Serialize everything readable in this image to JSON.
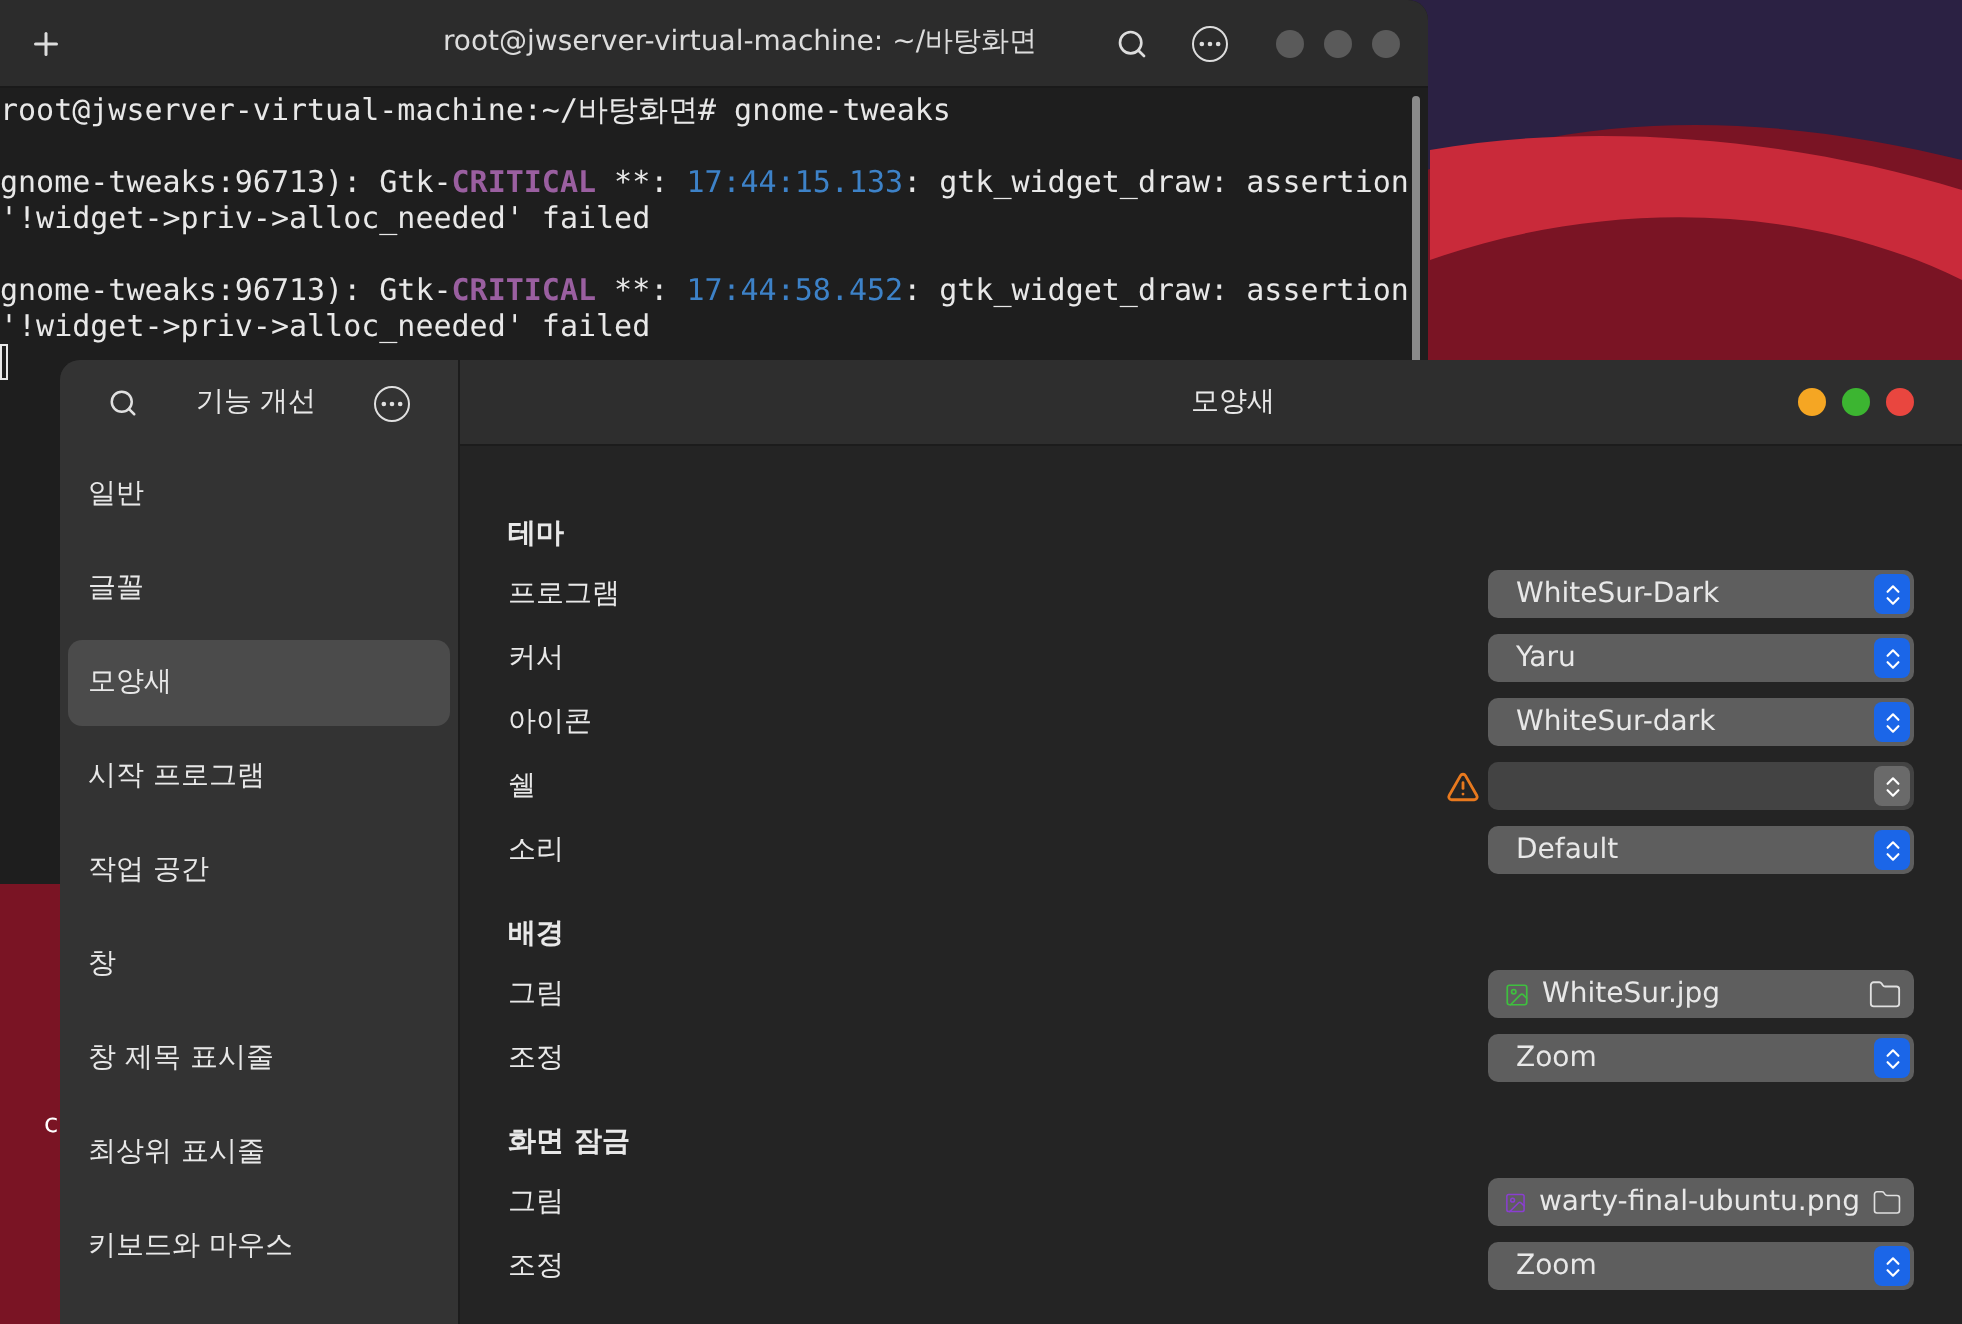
{
  "desktop": {
    "icon_label": "c"
  },
  "terminal": {
    "title": "root@jwserver-virtual-machine: ~/바탕화면",
    "blocks": [
      {
        "lines": [
          [
            {
              "text": "root@jwserver-virtual-machine:~/바탕화면# gnome-tweaks",
              "kind": "plain"
            }
          ]
        ]
      },
      {
        "lines": [
          [
            {
              "text": "gnome-tweaks:96713): Gtk-",
              "kind": "plain"
            },
            {
              "text": "CRITICAL",
              "kind": "critical"
            },
            {
              "text": " **: ",
              "kind": "plain"
            },
            {
              "text": "17:44:15.133",
              "kind": "time"
            },
            {
              "text": ": gtk_widget_draw: assertion",
              "kind": "plain"
            }
          ],
          [
            {
              "text": "'!widget->priv->alloc_needed' failed",
              "kind": "plain"
            }
          ]
        ]
      },
      {
        "lines": [
          [
            {
              "text": "gnome-tweaks:96713): Gtk-",
              "kind": "plain"
            },
            {
              "text": "CRITICAL",
              "kind": "critical"
            },
            {
              "text": " **: ",
              "kind": "plain"
            },
            {
              "text": "17:44:58.452",
              "kind": "time"
            },
            {
              "text": ": gtk_widget_draw: assertion",
              "kind": "plain"
            }
          ],
          [
            {
              "text": "'!widget->priv->alloc_needed' failed",
              "kind": "plain"
            }
          ]
        ]
      }
    ]
  },
  "tweaks": {
    "app_title": "기능 개선",
    "page_title": "모양새",
    "sidebar": {
      "items": [
        {
          "label": "일반",
          "selected": false
        },
        {
          "label": "글꼴",
          "selected": false
        },
        {
          "label": "모양새",
          "selected": true
        },
        {
          "label": "시작 프로그램",
          "selected": false
        },
        {
          "label": "작업 공간",
          "selected": false
        },
        {
          "label": "창",
          "selected": false
        },
        {
          "label": "창 제목 표시줄",
          "selected": false
        },
        {
          "label": "최상위 표시줄",
          "selected": false
        },
        {
          "label": "키보드와 마우스",
          "selected": false
        }
      ]
    },
    "sections": [
      {
        "title": "테마",
        "rows": [
          {
            "label": "프로그램",
            "kind": "combo",
            "value": "WhiteSur-Dark",
            "disabled": false,
            "warning": false
          },
          {
            "label": "커서",
            "kind": "combo",
            "value": "Yaru",
            "disabled": false,
            "warning": false
          },
          {
            "label": "아이콘",
            "kind": "combo",
            "value": "WhiteSur-dark",
            "disabled": false,
            "warning": false
          },
          {
            "label": "쉘",
            "kind": "combo",
            "disabled": true,
            "warning": true
          },
          {
            "label": "소리",
            "kind": "combo",
            "value": "Default",
            "disabled": false,
            "warning": false
          }
        ]
      },
      {
        "title": "배경",
        "rows": [
          {
            "label": "그림",
            "kind": "file",
            "value": "WhiteSur.jpg",
            "color": "#3fbf3f"
          },
          {
            "label": "조정",
            "kind": "combo",
            "value": "Zoom",
            "disabled": false,
            "warning": false
          }
        ]
      },
      {
        "title": "화면 잠금",
        "rows": [
          {
            "label": "그림",
            "kind": "file",
            "value": "warty-final-ubuntu.png",
            "color": "#8a3fd0"
          },
          {
            "label": "조정",
            "kind": "combo",
            "value": "Zoom",
            "disabled": false,
            "warning": false
          }
        ]
      }
    ]
  }
}
